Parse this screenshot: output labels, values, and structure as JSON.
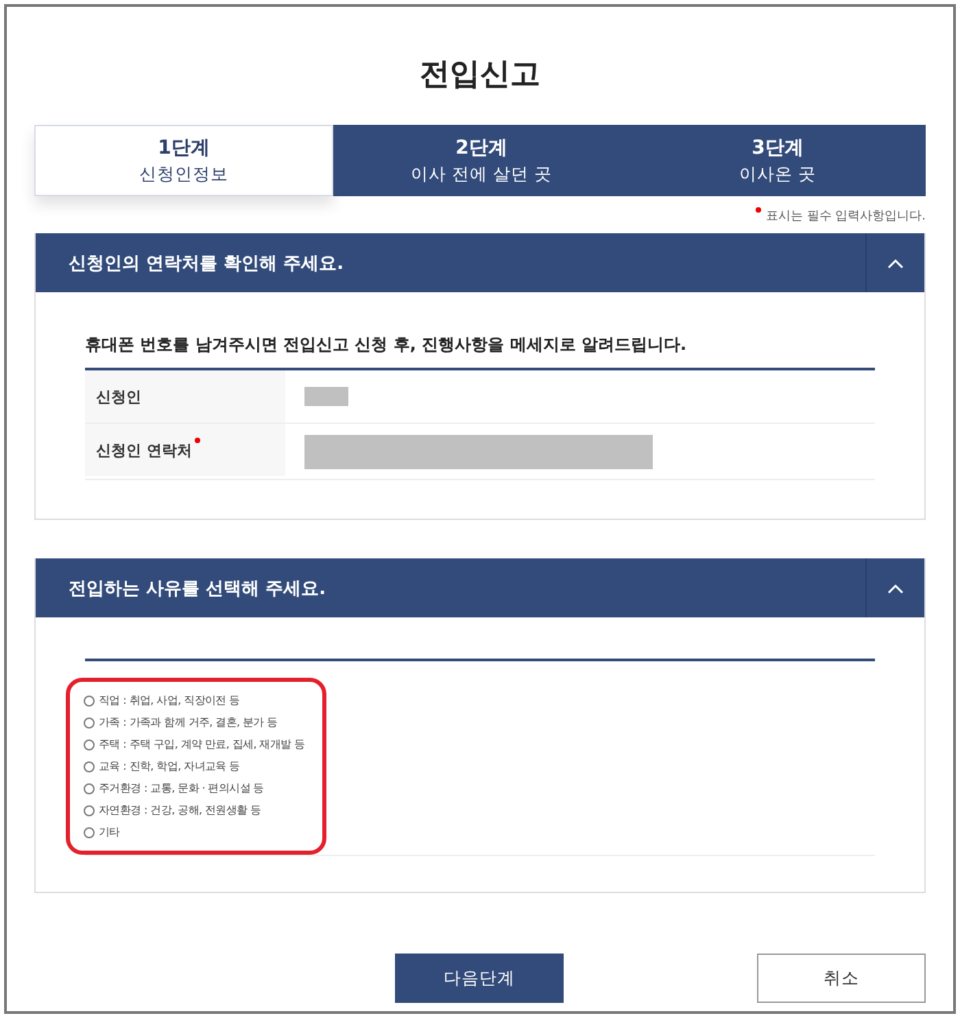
{
  "title": "전입신고",
  "steps": [
    {
      "number": "1단계",
      "label": "신청인정보",
      "selected": true
    },
    {
      "number": "2단계",
      "label": "이사 전에 살던 곳",
      "selected": false
    },
    {
      "number": "3단계",
      "label": "이사온 곳",
      "selected": false
    }
  ],
  "required_note": "표시는 필수 입력사항입니다.",
  "sections": [
    {
      "kind": "contact",
      "title": "신청인의 연락처를 확인해 주세요.",
      "expanded": true,
      "notice": "휴대폰 번호를 남겨주시면 전입신고 신청 후, 진행사항을 메세지로 알려드립니다.",
      "rows": [
        {
          "label": "신청인",
          "kind": "name",
          "required": false,
          "masked": true
        },
        {
          "label": "신청인 연락처",
          "kind": "phone",
          "required": true,
          "masked": true
        }
      ]
    },
    {
      "kind": "reasons",
      "title": "전입하는 사유를 선택해 주세요.",
      "expanded": true,
      "highlighted": true,
      "options": [
        {
          "label": "직업 : 취업, 사업, 직장이전 등",
          "selected": false
        },
        {
          "label": "가족 : 가족과 함께 거주, 결혼, 분가 등",
          "selected": false
        },
        {
          "label": "주택 : 주택 구입, 계약 만료, 집세, 재개발 등",
          "selected": false
        },
        {
          "label": "교육 : 진학, 학업, 자녀교육 등",
          "selected": false
        },
        {
          "label": "주거환경 : 교통, 문화 · 편의시설 등",
          "selected": false
        },
        {
          "label": "자연환경 : 건강, 공해, 전원생활 등",
          "selected": false
        },
        {
          "label": "기타",
          "selected": false
        }
      ]
    }
  ],
  "buttons": [
    {
      "label": "다음단계",
      "kind": "primary"
    },
    {
      "label": "취소",
      "kind": "secondary"
    }
  ]
}
